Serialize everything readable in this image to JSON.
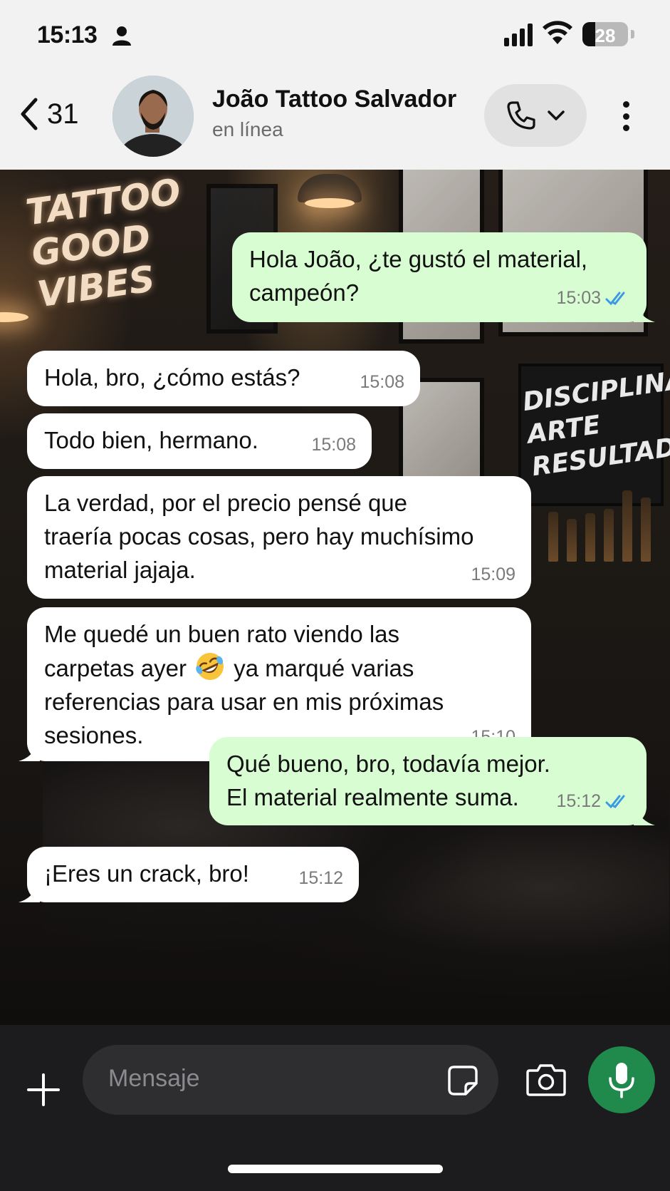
{
  "status_bar": {
    "time": "15:13",
    "battery_level": "28",
    "battery_fraction": 0.28
  },
  "header": {
    "back_count": "31",
    "contact_name": "João Tattoo Salvador",
    "contact_status": "en línea"
  },
  "background": {
    "neon_sign": "TATTOO\nGOOD\nVIBES",
    "chalk_sign": "DISCIPLINA\nARTE\nRESULTADOS"
  },
  "messages": [
    {
      "direction": "out",
      "text": "Hola João, ¿te gustó el material,\ncampeón?",
      "time": "15:03",
      "status": "read"
    },
    {
      "direction": "in",
      "text": "Hola, bro, ¿cómo estás?",
      "time": "15:08"
    },
    {
      "direction": "in",
      "text": "Todo bien, hermano.",
      "time": "15:08"
    },
    {
      "direction": "in",
      "text": "La verdad, por el precio pensé que\ntraería pocas cosas, pero hay muchísimo\nmaterial jajaja.",
      "time": "15:09"
    },
    {
      "direction": "in",
      "text_before_emoji": "Me quedé un buen rato viendo las\ncarpetas ayer ",
      "emoji": "rolling-on-floor-laughing",
      "text_after_emoji": " ya marqué varias\nreferencias para usar en mis próximas\nsesiones.",
      "time": "15:10"
    },
    {
      "direction": "out",
      "text": "Qué bueno, bro, todavía mejor.\nEl material realmente suma.",
      "time": "15:12",
      "status": "read"
    },
    {
      "direction": "in",
      "text": "¡Eres un crack, bro!",
      "time": "15:12"
    }
  ],
  "input": {
    "placeholder": "Mensaje"
  },
  "colors": {
    "outgoing_bubble": "#d9fdd3",
    "incoming_bubble": "#ffffff",
    "read_ticks": "#3b9ae1",
    "mic_button": "#1f8a4c"
  }
}
